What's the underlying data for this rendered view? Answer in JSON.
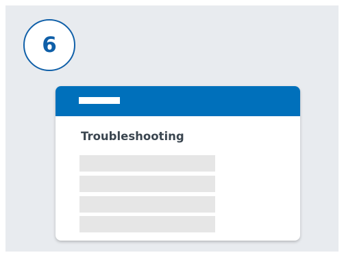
{
  "step": {
    "number": "6"
  },
  "window": {
    "heading": "Troubleshooting",
    "placeholder_rows": 4
  },
  "colors": {
    "background": "#e8ebef",
    "accent": "#0070bb",
    "badge": "#0f5fa8",
    "heading_text": "#3b4650",
    "placeholder": "#e6e6e6"
  }
}
